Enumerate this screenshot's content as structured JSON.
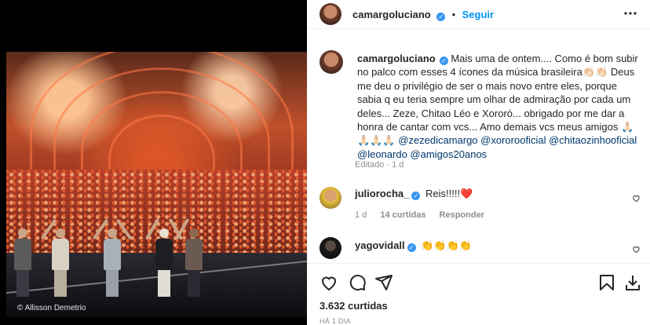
{
  "post": {
    "photo_credit": "© Allisson Demetrio",
    "author": {
      "username": "camargoluciano",
      "follow_label": "Seguir",
      "separator": "•"
    },
    "caption": {
      "username": "camargoluciano",
      "text": "Mais uma de ontem.... Como é bom subir no palco com esses 4 ícones da música brasileira👏🏻👏🏻 Deus me deu o privilégio de ser o mais novo entre eles, porque sabia q eu teria sempre um olhar de admiração por cada um deles... Zeze, Chitao Léo e Xororó... obrigado por me dar a honra de cantar com vcs... Amo demais vcs meus amigos 🙏🏻🙏🏻🙏🏻🙏🏻",
      "mentions": [
        "@zezedicamargo",
        "@xororooficial",
        "@chitaozinhooficial",
        "@leonardo",
        "@amigos20anos"
      ],
      "edited_label": "Editado · 1 d"
    },
    "comments": [
      {
        "username": "juliorocha_",
        "text": "Reis!!!!!❤️",
        "age": "1 d",
        "likes_label": "14 curtidas",
        "reply_label": "Responder"
      },
      {
        "username": "yagovidall",
        "text": "👏👏👏👏"
      }
    ],
    "likes_label": "3.632 curtidas",
    "timestamp": "HÁ 1 DIA"
  },
  "icons": {
    "more": "more-options-icon",
    "like": "heart-icon",
    "comment": "comment-icon",
    "share": "share-icon",
    "save": "bookmark-icon",
    "download": "download-icon"
  },
  "colors": {
    "accent": "#0095f6",
    "verified": "#3897f0",
    "mention": "#00376b",
    "muted": "#8e8e8e"
  }
}
